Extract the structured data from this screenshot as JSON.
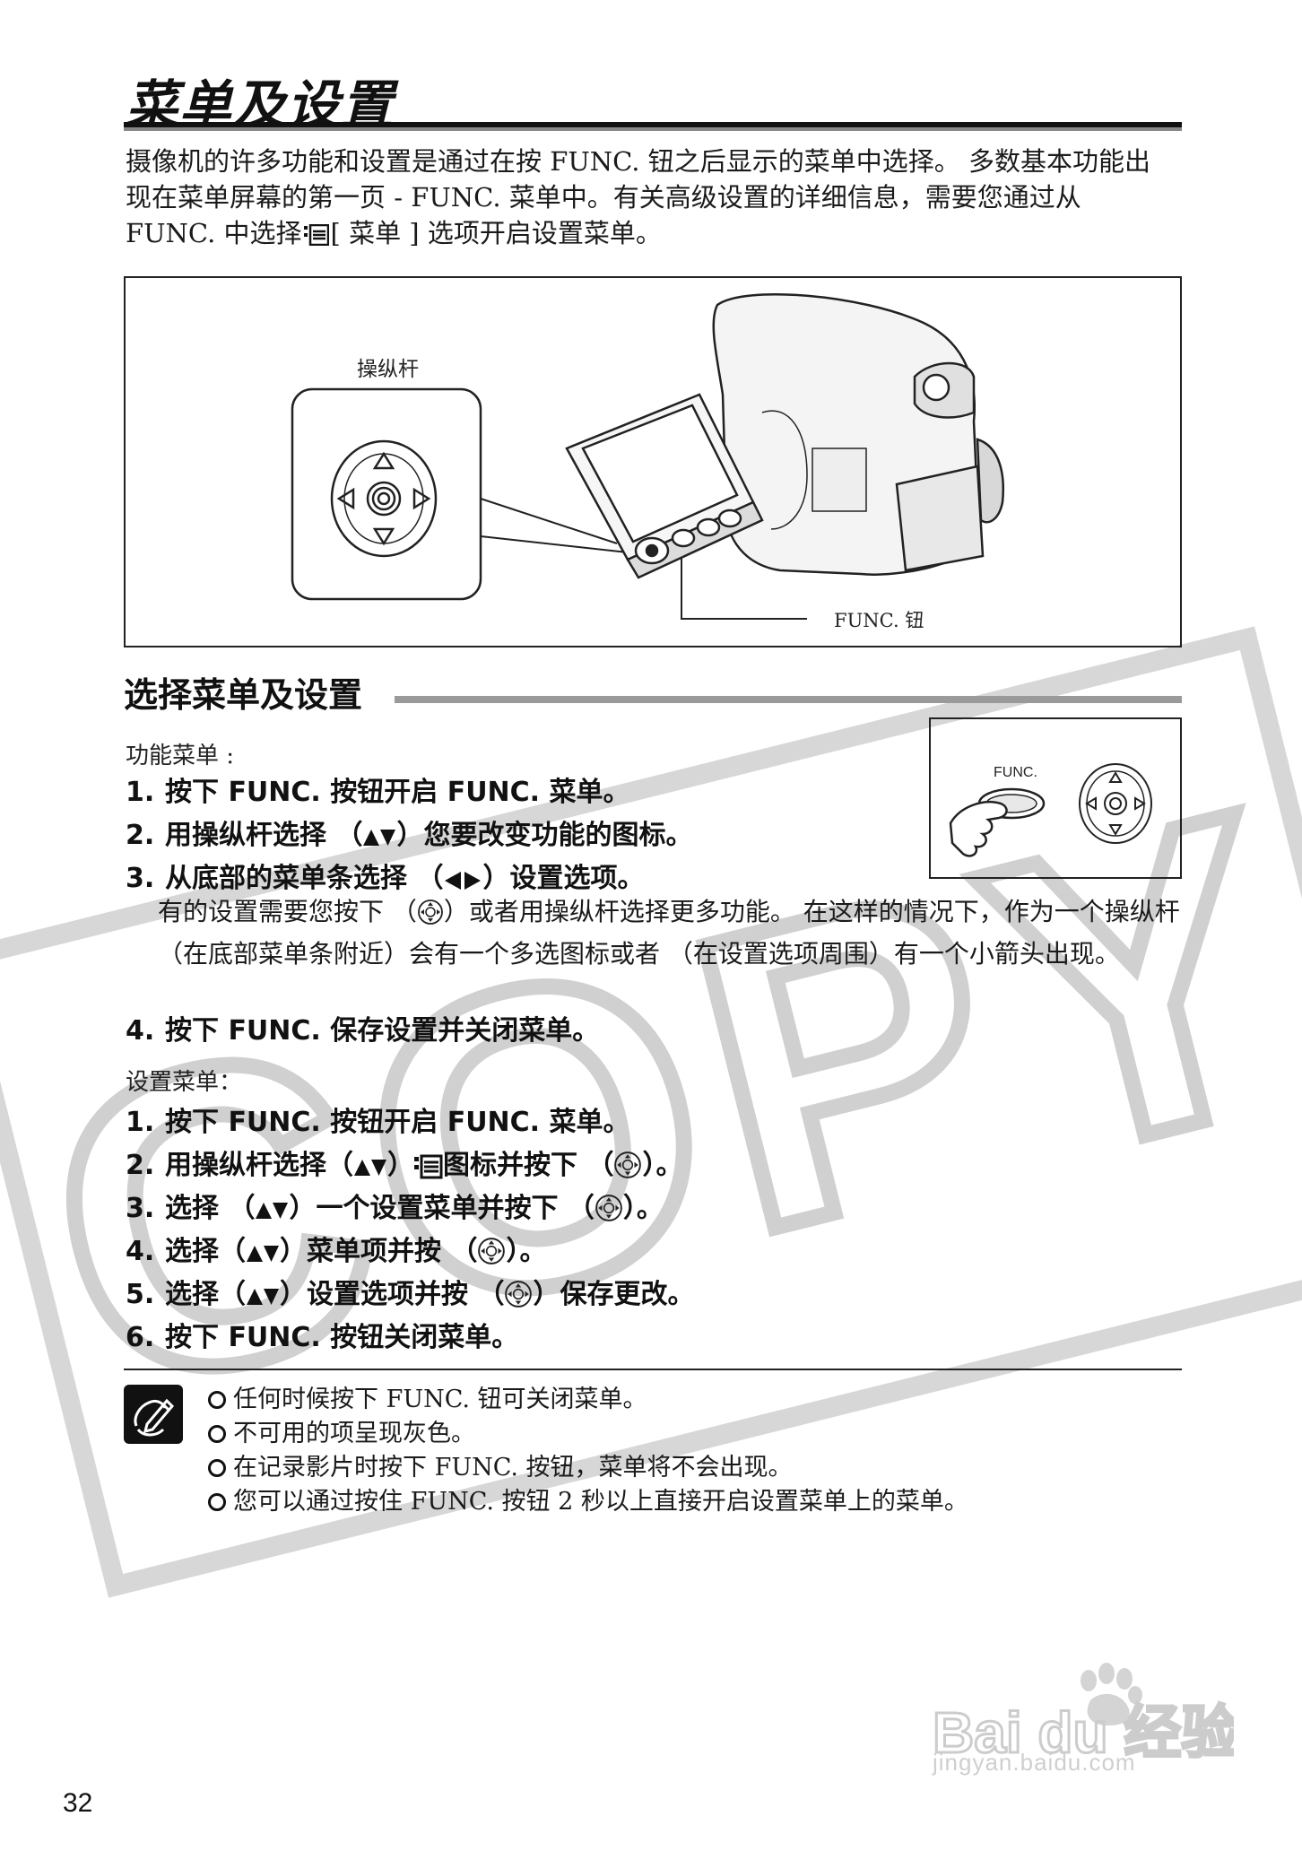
{
  "page": {
    "title": "菜单及设置",
    "intro_part1": "摄像机的许多功能和设置是通过在按 FUNC. 钮之后显示的菜单中选择。 多数基本功能出现在菜单屏幕的第一页 - FUNC. 菜单中。有关高级设置的详细信息，需要您通过从 FUNC. 中选择",
    "intro_part2": "[ 菜单 ] 选项开启设置菜单。",
    "page_number": "32"
  },
  "figure": {
    "joystick_label": "操纵杆",
    "func_button_label": "FUNC. 钮",
    "func_inset_label": "FUNC."
  },
  "section": {
    "title": "选择菜单及设置"
  },
  "func_menu": {
    "heading": "功能菜单 :",
    "steps": [
      {
        "num": "1.",
        "text": "按下 FUNC. 按钮开启 FUNC. 菜单。"
      },
      {
        "num": "2.",
        "pre": "用操纵杆选择 （",
        "icon": "▲▼",
        "post": "）您要改变功能的图标。"
      },
      {
        "num": "3.",
        "pre": "从底部的菜单条选择 （",
        "icon": "◀▶",
        "post": "）设置选项。"
      },
      {
        "num": "4.",
        "text": "按下 FUNC. 保存设置并关闭菜单。"
      }
    ],
    "step3_note_pre": "有的设置需要您按下 （",
    "step3_note_post": "）或者用操纵杆选择更多功能。 在这样的情况下，作为一个操纵杆 （在底部菜单条附近）会有一个多选图标或者 （在设置选项周围）有一个小箭头出现。"
  },
  "setup_menu": {
    "heading": "设置菜单：",
    "steps": [
      {
        "num": "1.",
        "text": "按下 FUNC. 按钮开启 FUNC. 菜单。"
      },
      {
        "num": "2.",
        "pre": "用操纵杆选择（",
        "icon": "▲▼",
        "mid": "）",
        "mid2": "图标并按下 （",
        "post": "）。"
      },
      {
        "num": "3.",
        "pre": "选择 （",
        "icon": "▲▼",
        "mid": "）一个设置菜单并按下 （",
        "post": "）。"
      },
      {
        "num": "4.",
        "pre": "选择（",
        "icon": "▲▼",
        "mid": "）菜单项并按 （",
        "post": "）。"
      },
      {
        "num": "5.",
        "pre": "选择（",
        "icon": "▲▼",
        "mid": "）设置选项并按 （",
        "post": "）保存更改。"
      },
      {
        "num": "6.",
        "text": "按下 FUNC. 按钮关闭菜单。"
      }
    ]
  },
  "notes": [
    "任何时候按下 FUNC. 钮可关闭菜单。",
    "不可用的项呈现灰色。",
    "在记录影片时按下 FUNC. 按钮，菜单将不会出现。",
    "您可以通过按住 FUNC. 按钮 2 秒以上直接开启设置菜单上的菜单。"
  ],
  "watermark": {
    "copy_text": "COPY",
    "baidu_logo_text": "Bai du 经验",
    "baidu_url": "jingyan.baidu.com"
  },
  "icons": [
    "menu-icon",
    "joystick-press-icon",
    "up-down-arrows-icon",
    "left-right-arrows-icon",
    "pencil-note-icon",
    "camcorder-illustration",
    "joystick-inset"
  ]
}
